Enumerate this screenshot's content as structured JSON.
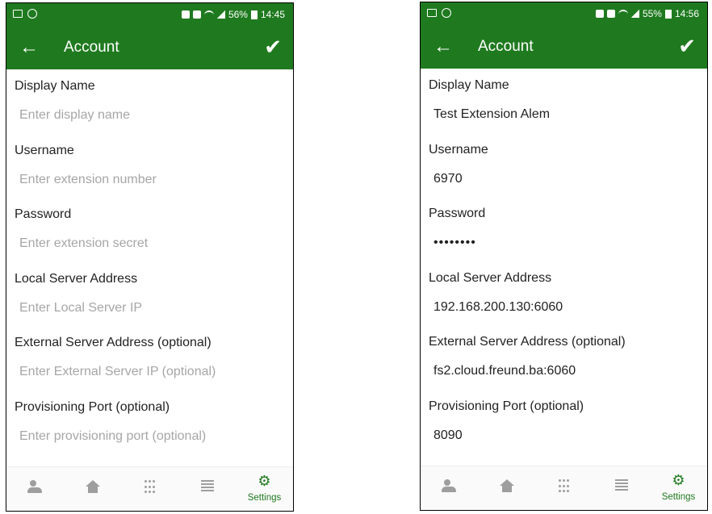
{
  "screens": [
    {
      "status": {
        "battery": "56%",
        "time": "14:45"
      },
      "toolbar": {
        "title": "Account"
      },
      "fields": [
        {
          "label": "Display Name",
          "value": "",
          "placeholder": "Enter display name"
        },
        {
          "label": "Username",
          "value": "",
          "placeholder": "Enter extension number"
        },
        {
          "label": "Password",
          "value": "",
          "placeholder": "Enter extension secret"
        },
        {
          "label": "Local Server Address",
          "value": "",
          "placeholder": "Enter Local Server IP"
        },
        {
          "label": "External Server Address (optional)",
          "value": "",
          "placeholder": "Enter External Server IP (optional)"
        },
        {
          "label": "Provisioning Port (optional)",
          "value": "",
          "placeholder": "Enter provisioning port (optional)"
        }
      ],
      "nav": {
        "settings_label": "Settings"
      }
    },
    {
      "status": {
        "battery": "55%",
        "time": "14:56"
      },
      "toolbar": {
        "title": "Account"
      },
      "fields": [
        {
          "label": "Display Name",
          "value": "Test Extension Alem",
          "placeholder": ""
        },
        {
          "label": "Username",
          "value": "6970",
          "placeholder": ""
        },
        {
          "label": "Password",
          "value": "••••••••",
          "placeholder": ""
        },
        {
          "label": "Local Server Address",
          "value": "192.168.200.130:6060",
          "placeholder": ""
        },
        {
          "label": "External Server Address (optional)",
          "value": "fs2.cloud.freund.ba:6060",
          "placeholder": ""
        },
        {
          "label": "Provisioning Port (optional)",
          "value": "8090",
          "placeholder": ""
        }
      ],
      "nav": {
        "settings_label": "Settings"
      }
    }
  ],
  "colors": {
    "primary": "#1f7a1f",
    "placeholder": "#a6a6a6",
    "nav_inactive": "#9e9e9e"
  },
  "icons": [
    "back-arrow-icon",
    "check-icon",
    "contacts-icon",
    "home-icon",
    "dialpad-icon",
    "call-log-icon",
    "settings-gear-icon"
  ]
}
